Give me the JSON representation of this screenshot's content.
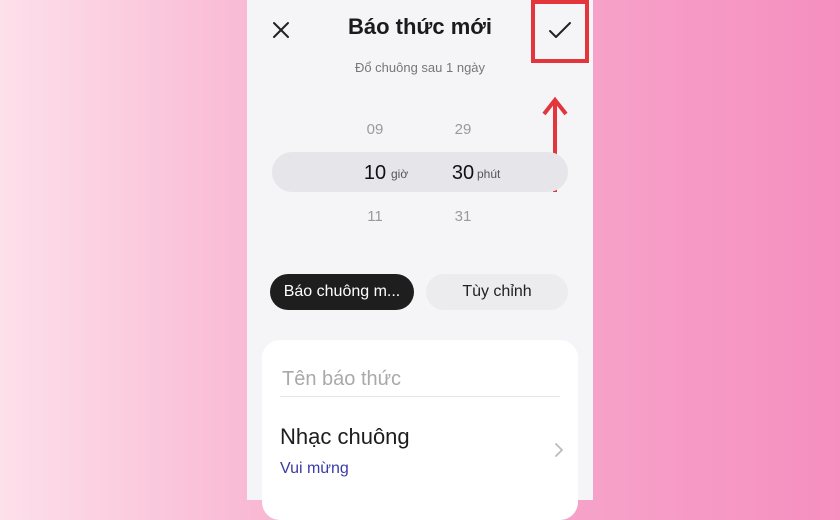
{
  "header": {
    "title": "Báo thức mới",
    "subtitle": "Đổ chuông sau 1 ngày",
    "close_icon": "close-icon",
    "confirm_icon": "check-icon"
  },
  "picker": {
    "hours": {
      "prev": "09",
      "selected": "10",
      "next": "11",
      "unit": "giờ"
    },
    "minutes": {
      "prev": "29",
      "selected": "30",
      "next": "31",
      "unit": "phút"
    }
  },
  "tabs": [
    {
      "label": "Báo chuông m...",
      "active": true
    },
    {
      "label": "Tùy chỉnh",
      "active": false
    }
  ],
  "form": {
    "name_placeholder": "Tên báo thức",
    "name_value": "",
    "ringtone_label": "Nhạc chuông",
    "ringtone_value": "Vui mừng"
  },
  "colors": {
    "highlight": "#e2353c",
    "ringtone_value": "#3a3aa8",
    "active_tab": "#1e1e1e"
  }
}
